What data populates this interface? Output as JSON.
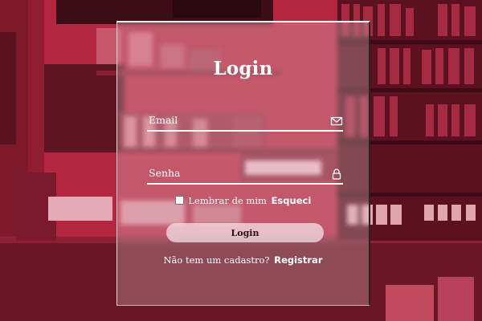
{
  "form": {
    "title": "Login",
    "email_placeholder": "Email",
    "email_value": "",
    "email_icon": "envelope-icon",
    "password_placeholder": "Senha",
    "password_value": "",
    "password_icon": "lock-icon",
    "remember_checked": false,
    "remember_label": "Lembrar de mim",
    "forgot_label": "Esqueci",
    "login_button_label": "Login",
    "register_prompt": "Não tem um cadastro?",
    "register_link_label": "Registrar"
  },
  "colors": {
    "background_tint": "#b8243c",
    "text": "#ffffff",
    "button_bg": "#f5e8ec",
    "button_text": "#2a1218"
  }
}
